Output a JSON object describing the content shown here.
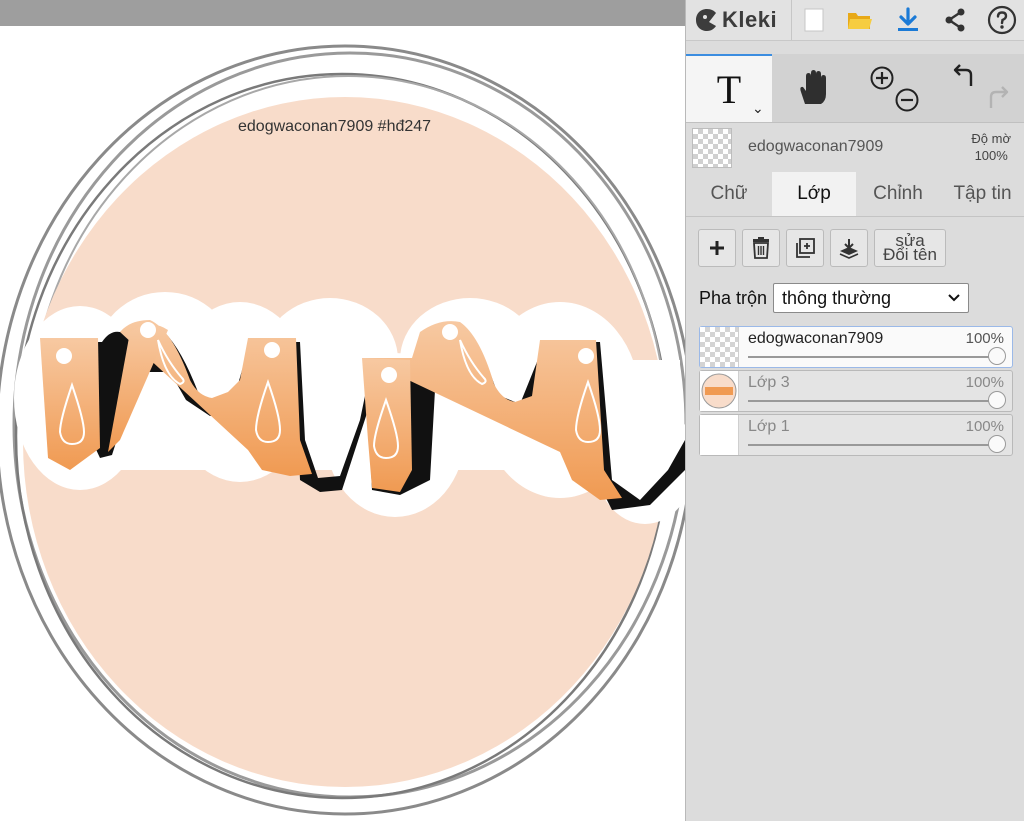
{
  "app": {
    "name": "Kleki"
  },
  "canvas": {
    "watermark": "edogwaconan7909   #hđ247"
  },
  "topbar": {
    "icons": [
      "new-image-icon",
      "open-folder-icon",
      "download-icon",
      "share-icon",
      "help-icon"
    ],
    "colors": {
      "folder": "#f2c12e",
      "download": "#1b7ad6",
      "accent": "#3b8de0"
    }
  },
  "tools": {
    "text_tool": "T",
    "icons": [
      "text-tool-icon",
      "hand-tool-icon",
      "zoom-in-icon",
      "zoom-out-icon",
      "undo-icon",
      "redo-icon"
    ]
  },
  "layer_info": {
    "name": "edogwaconan7909",
    "opacity_label": "Độ mờ",
    "opacity_value": "100%"
  },
  "tabs": [
    {
      "label": "Chữ",
      "active": false
    },
    {
      "label": "Lớp",
      "active": true
    },
    {
      "label": "Chỉnh",
      "active": false
    },
    {
      "label": "Tập tin",
      "active": false
    }
  ],
  "layer_actions": {
    "rename_line1": "sửa",
    "rename_line2": "Đổi tên"
  },
  "blend": {
    "label": "Pha trộn",
    "value": "thông thường"
  },
  "layers": [
    {
      "name": "edogwaconan7909",
      "opacity": "100%",
      "opacity_level": 1.0
    },
    {
      "name": "Lớp 3",
      "opacity": "100%",
      "opacity_level": 1.0
    },
    {
      "name": "Lớp 1",
      "opacity": "100%",
      "opacity_level": 1.0
    }
  ]
}
